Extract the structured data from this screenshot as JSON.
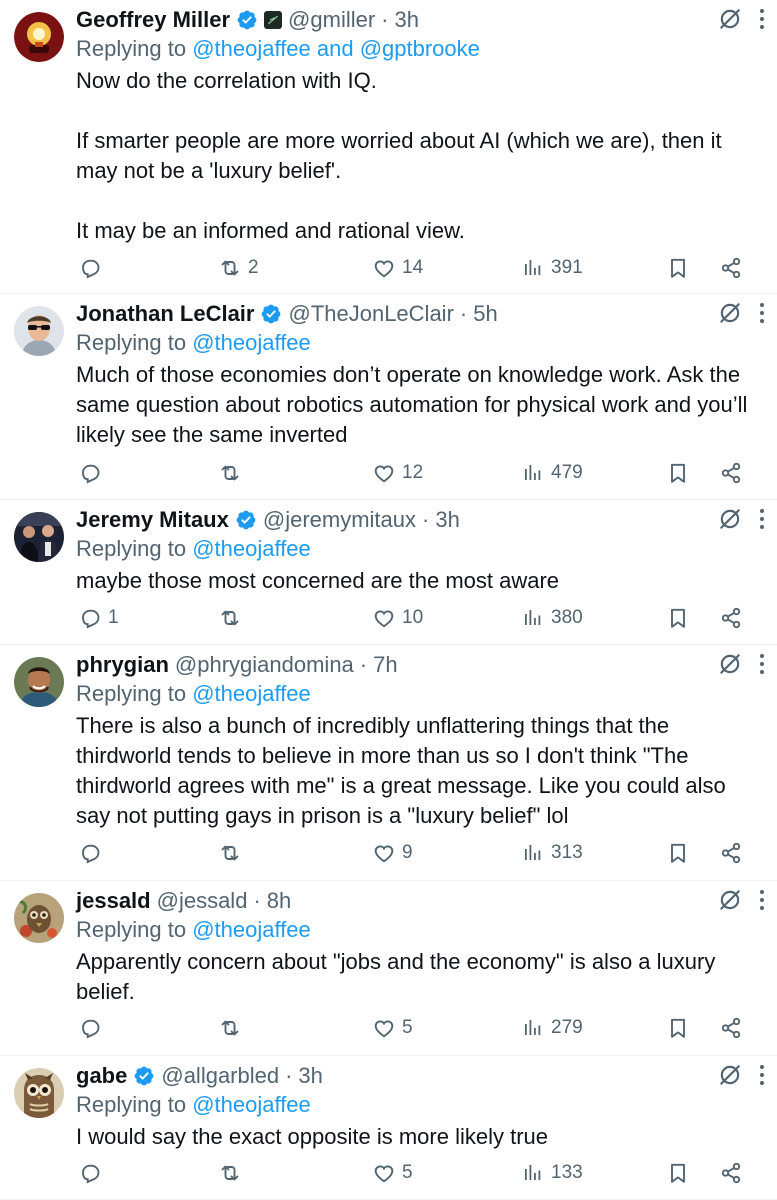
{
  "replying_prefix": "Replying to",
  "replies": [
    {
      "name": "Geoffrey Miller",
      "verified": true,
      "affiliate_badge": true,
      "handle": "@gmiller",
      "time": "3h",
      "replying_to": "@theojaffee and @gptbrooke",
      "text": "Now do the correlation with IQ.\n\nIf smarter people are more worried about AI (which we are), then it may not be a 'luxury belief'.\n\nIt may be an informed and rational view.",
      "reply_count": "",
      "retweet_count": "2",
      "like_count": "14",
      "view_count": "391",
      "avatar_icon": "lamp-avatar"
    },
    {
      "name": "Jonathan LeClair",
      "verified": true,
      "affiliate_badge": false,
      "handle": "@TheJonLeClair",
      "time": "5h",
      "replying_to": "@theojaffee",
      "text": "Much of those economies don’t operate on knowledge work. Ask the same question about robotics automation for physical work and you’ll likely see the same inverted",
      "reply_count": "",
      "retweet_count": "",
      "like_count": "12",
      "view_count": "479",
      "avatar_icon": "sunglasses-avatar"
    },
    {
      "name": "Jeremy Mitaux",
      "verified": true,
      "affiliate_badge": false,
      "handle": "@jeremymitaux",
      "time": "3h",
      "replying_to": "@theojaffee",
      "text": "maybe those most concerned are the most aware",
      "reply_count": "1",
      "retweet_count": "",
      "like_count": "10",
      "view_count": "380",
      "avatar_icon": "group-photo-avatar"
    },
    {
      "name": "phrygian",
      "verified": false,
      "affiliate_badge": false,
      "handle": "@phrygiandomina",
      "time": "7h",
      "replying_to": "@theojaffee",
      "text": "There is also a bunch of incredibly unflattering things that the thirdworld tends to believe in more than us so I don't think \"The thirdworld agrees with me\" is a great message. Like you could also say not putting gays in prison is a \"luxury belief\" lol",
      "reply_count": "",
      "retweet_count": "",
      "like_count": "9",
      "view_count": "313",
      "avatar_icon": "smiling-man-avatar"
    },
    {
      "name": "jessald",
      "verified": false,
      "affiliate_badge": false,
      "handle": "@jessald",
      "time": "8h",
      "replying_to": "@theojaffee",
      "text": "Apparently concern about \"jobs and the economy\" is also a luxury belief.",
      "reply_count": "",
      "retweet_count": "",
      "like_count": "5",
      "view_count": "279",
      "avatar_icon": "painting-avatar"
    },
    {
      "name": "gabe",
      "verified": true,
      "affiliate_badge": false,
      "handle": "@allgarbled",
      "time": "3h",
      "replying_to": "@theojaffee",
      "text": "I would say the exact opposite is more likely true",
      "reply_count": "",
      "retweet_count": "",
      "like_count": "5",
      "view_count": "133",
      "avatar_icon": "owl-avatar"
    }
  ],
  "colors": {
    "text": "#0f1419",
    "muted": "#536471",
    "link": "#1d9bf0",
    "verified": "#1d9bf0",
    "divider": "#eff3f4"
  }
}
